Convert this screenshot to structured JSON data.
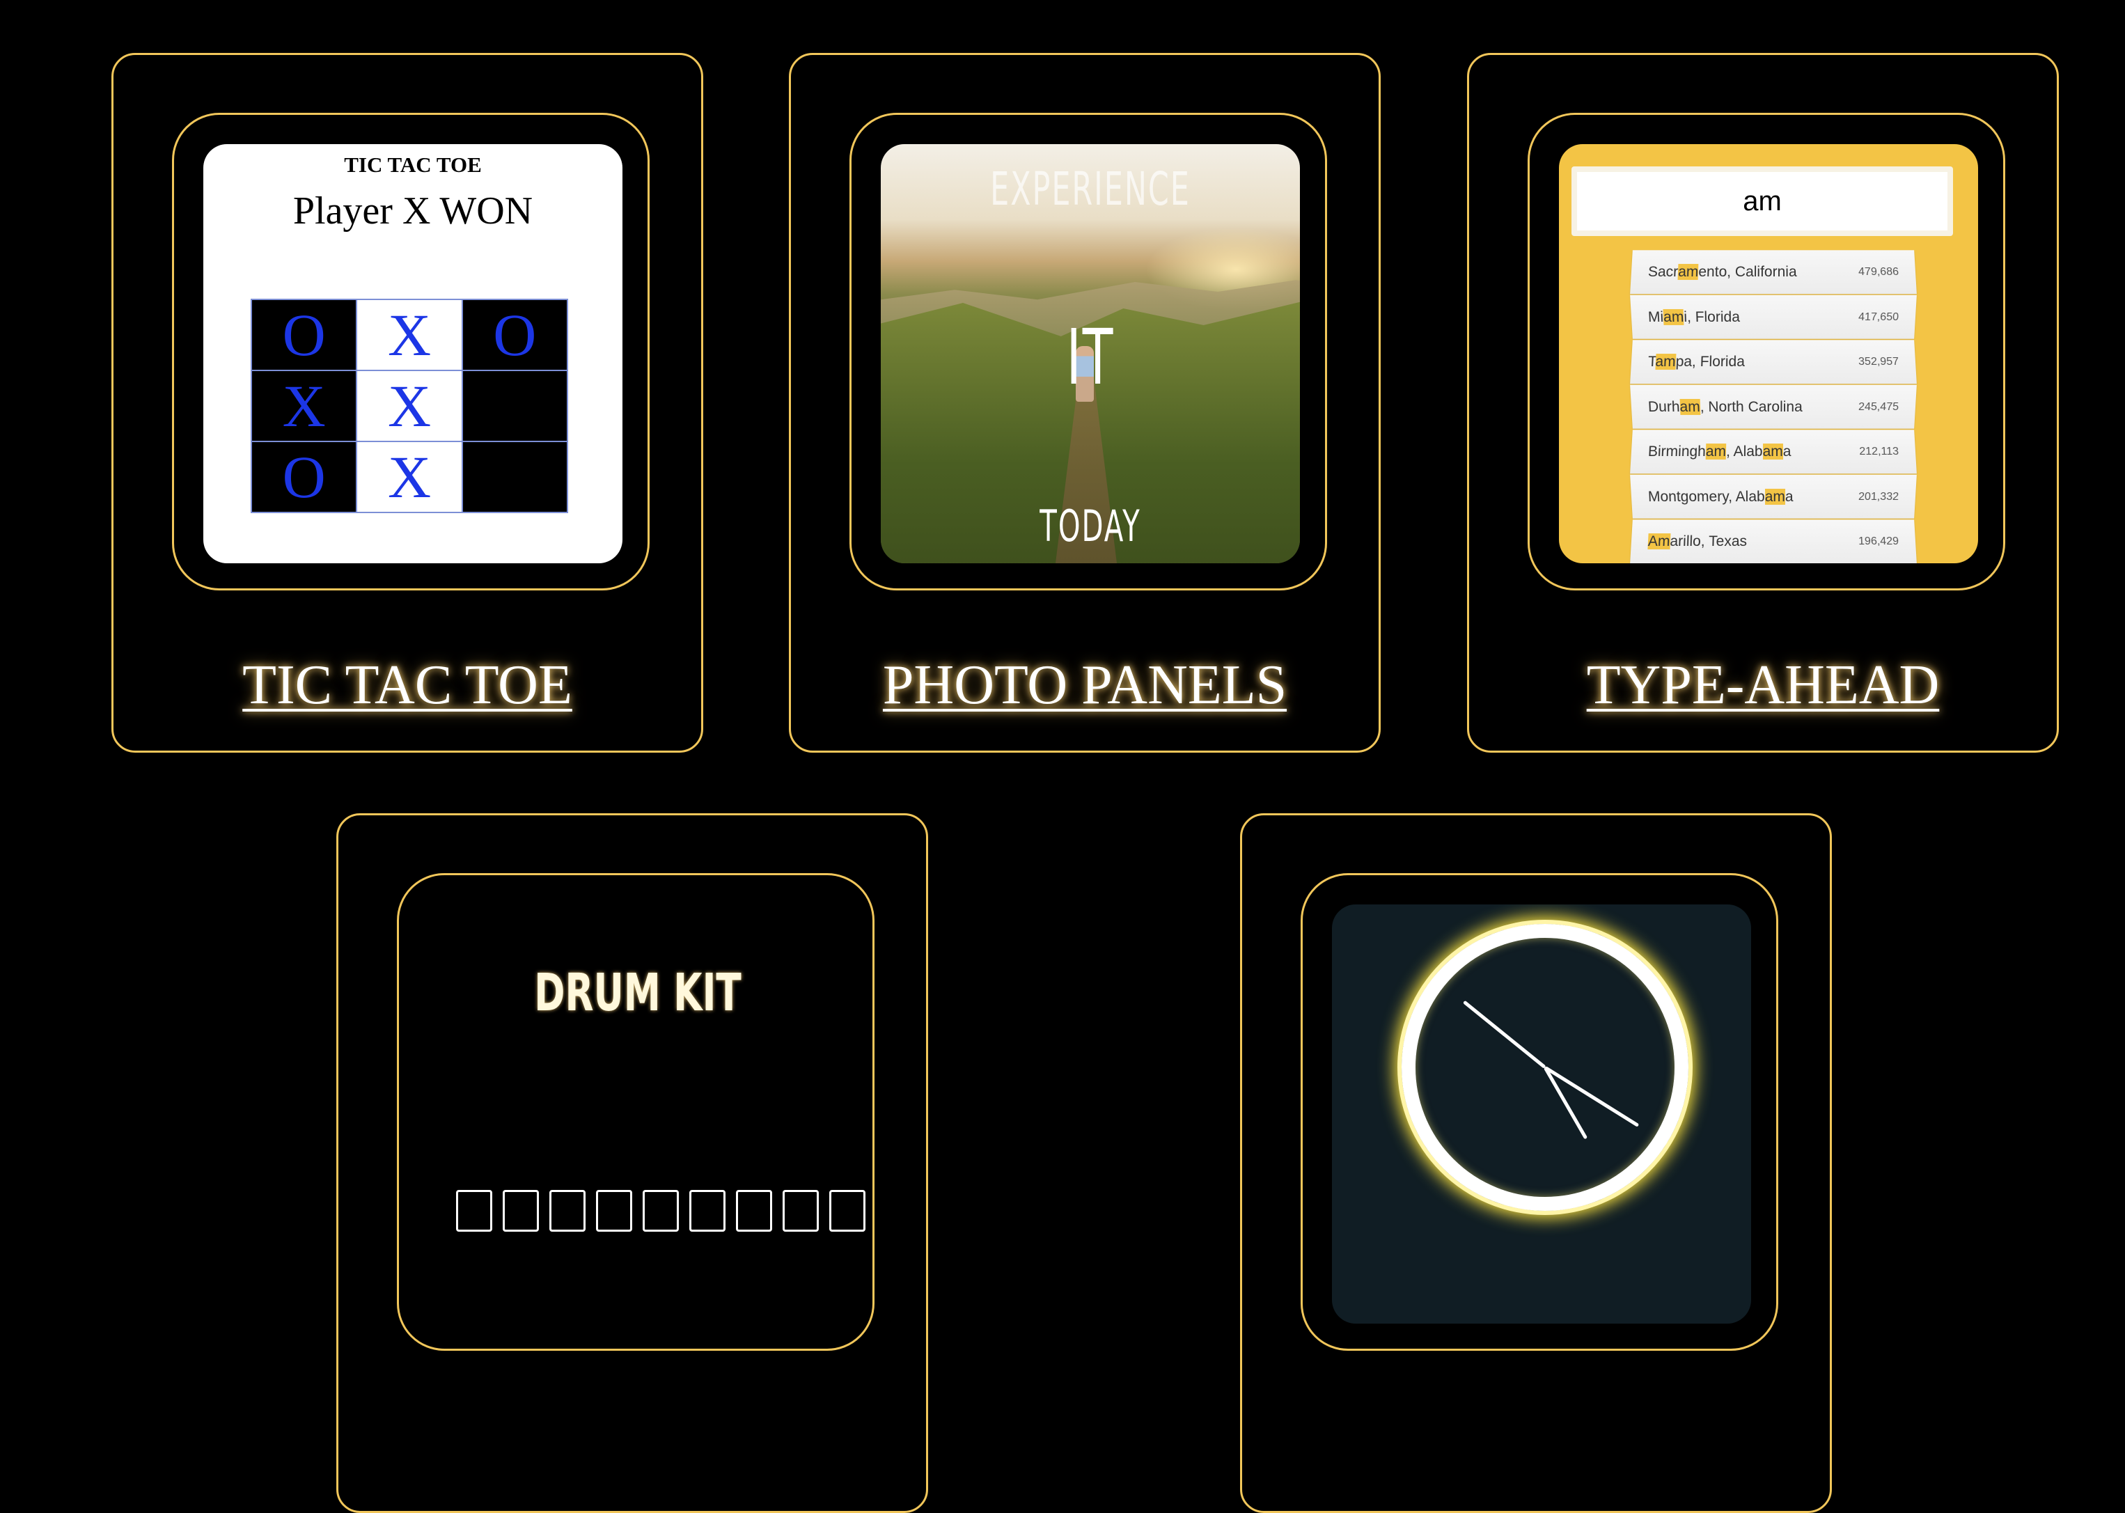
{
  "projects": [
    {
      "title": "TIC TAC TOE",
      "preview": {
        "heading": "TIC TAC TOE",
        "status": "Player X WON",
        "board": [
          "O",
          "X",
          "O",
          "X",
          "X",
          "",
          "O",
          "X",
          ""
        ]
      }
    },
    {
      "title": "PHOTO PANELS",
      "preview": {
        "words": [
          "EXPERIENCE",
          "IT",
          "TODAY"
        ]
      }
    },
    {
      "title": "TYPE-AHEAD",
      "preview": {
        "query": "am",
        "results": [
          {
            "pre": "Sacr",
            "hl": "am",
            "post": "ento, California",
            "population": "479,686"
          },
          {
            "pre": "Mi",
            "hl": "am",
            "post": "i, Florida",
            "population": "417,650"
          },
          {
            "pre": "T",
            "hl": "am",
            "post": "pa, Florida",
            "population": "352,957"
          },
          {
            "pre": "Durh",
            "hl": "am",
            "post": ", North Carolina",
            "population": "245,475"
          },
          {
            "pre": "Birmingh",
            "hl": "am",
            "post": ", Alab",
            "hl2": "am",
            "post2": "a",
            "population": "212,113"
          },
          {
            "pre": "Montgomery, Alab",
            "hl": "am",
            "post": "a",
            "population": "201,332"
          },
          {
            "pre": "",
            "hl": "Am",
            "post": "arillo, Texas",
            "population": "196,429"
          }
        ]
      }
    },
    {
      "title": "DRUM KIT",
      "preview": {
        "heading": "DRUM KIT",
        "keys": [
          "",
          "",
          "",
          "",
          "",
          "",
          "",
          "",
          ""
        ]
      }
    },
    {
      "title": "",
      "preview": {
        "hand_angles_deg": [
          -141,
          32,
          60
        ]
      }
    }
  ],
  "colors": {
    "background": "#000000",
    "card_border": "#f1c65a",
    "title_glow": "#ffd678",
    "ttt_mark": "#1c36e6",
    "typeahead_bg": "#f3c445",
    "clock_bg": "#101d24"
  }
}
